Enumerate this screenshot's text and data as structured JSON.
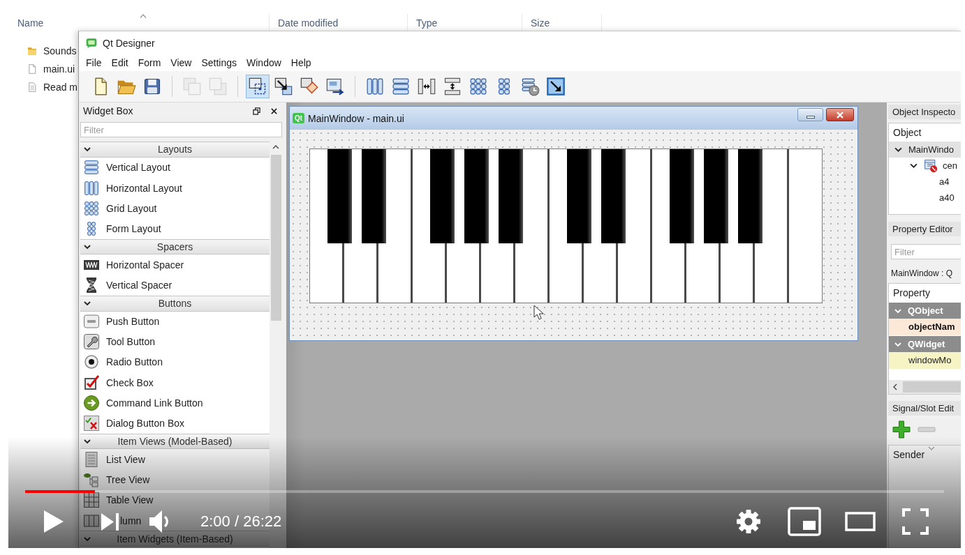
{
  "explorer": {
    "columns": [
      {
        "label": "Name",
        "sorted": true
      },
      {
        "label": "Date modified",
        "sorted": false
      },
      {
        "label": "Type",
        "sorted": false
      },
      {
        "label": "Size",
        "sorted": false
      }
    ],
    "files": [
      {
        "name": "Sounds",
        "kind": "folder"
      },
      {
        "name": "main.ui",
        "kind": "file"
      },
      {
        "name": "Read m",
        "kind": "document"
      }
    ]
  },
  "designer": {
    "title": "Qt Designer",
    "menu": [
      "File",
      "Edit",
      "Form",
      "View",
      "Settings",
      "Window",
      "Help"
    ],
    "toolbar": [
      [
        {
          "kind": "new",
          "disabled": false,
          "selected": false
        },
        {
          "kind": "open",
          "disabled": false,
          "selected": false
        },
        {
          "kind": "save",
          "disabled": false,
          "selected": false
        }
      ],
      [
        {
          "kind": "raise",
          "disabled": true,
          "selected": false
        },
        {
          "kind": "lower",
          "disabled": true,
          "selected": false
        }
      ],
      [
        {
          "kind": "edit-widgets",
          "disabled": false,
          "selected": true
        },
        {
          "kind": "edit-signals",
          "disabled": false,
          "selected": false
        },
        {
          "kind": "edit-buddies",
          "disabled": false,
          "selected": false
        },
        {
          "kind": "edit-tab-order",
          "disabled": false,
          "selected": false
        }
      ],
      [
        {
          "kind": "layout-h",
          "disabled": false,
          "selected": false
        },
        {
          "kind": "layout-v",
          "disabled": false,
          "selected": false
        },
        {
          "kind": "split-h",
          "disabled": false,
          "selected": false
        },
        {
          "kind": "split-v",
          "disabled": false,
          "selected": false
        },
        {
          "kind": "layout-grid",
          "disabled": false,
          "selected": false
        },
        {
          "kind": "layout-form",
          "disabled": false,
          "selected": false
        },
        {
          "kind": "break-layout",
          "disabled": false,
          "selected": false
        },
        {
          "kind": "adjust-size",
          "disabled": false,
          "selected": false
        }
      ]
    ],
    "widget_box": {
      "title": "Widget Box",
      "filter": {
        "placeholder": "Filter"
      },
      "groups": [
        {
          "title": "Layouts",
          "expanded": true,
          "items": [
            {
              "label": "Vertical Layout",
              "kind": "vbox"
            },
            {
              "label": "Horizontal Layout",
              "kind": "hbox"
            },
            {
              "label": "Grid Layout",
              "kind": "grid"
            },
            {
              "label": "Form Layout",
              "kind": "form"
            }
          ]
        },
        {
          "title": "Spacers",
          "expanded": true,
          "items": [
            {
              "label": "Horizontal Spacer",
              "kind": "hspacer"
            },
            {
              "label": "Vertical Spacer",
              "kind": "vspacer"
            }
          ]
        },
        {
          "title": "Buttons",
          "expanded": true,
          "items": [
            {
              "label": "Push Button",
              "kind": "push-button"
            },
            {
              "label": "Tool Button",
              "kind": "tool-button"
            },
            {
              "label": "Radio Button",
              "kind": "radio-button"
            },
            {
              "label": "Check Box",
              "kind": "check-box"
            },
            {
              "label": "Command Link Button",
              "kind": "command-link"
            },
            {
              "label": "Dialog Button Box",
              "kind": "dialog-buttons"
            }
          ]
        },
        {
          "title": "Item Views (Model-Based)",
          "expanded": true,
          "items": [
            {
              "label": "List View",
              "kind": "list-view"
            },
            {
              "label": "Tree View",
              "kind": "tree-view"
            },
            {
              "label": "Table View",
              "kind": "table-view"
            },
            {
              "label": "lumn",
              "kind": "column-view"
            }
          ]
        },
        {
          "title": "Item Widgets (Item-Based)",
          "expanded": true
        }
      ]
    },
    "form_window": {
      "logo": "Qt",
      "title": "MainWindow - main.ui"
    },
    "object_inspector": {
      "title": "Object Inspecto",
      "columns": [
        "Object"
      ],
      "tree": [
        {
          "label": "MainWindo",
          "selected": true,
          "expanded": true,
          "children": [
            {
              "label": "cen",
              "kind": "widget",
              "selected": false,
              "expanded": true,
              "children": [
                {
                  "label": "a4",
                  "selected": false
                },
                {
                  "label": "a40",
                  "selected": false
                }
              ]
            }
          ]
        }
      ]
    },
    "property_editor": {
      "title": "Property Editor",
      "filter": {
        "placeholder": "Filter"
      },
      "object": "MainWindow : Q",
      "columns": [
        "Property"
      ],
      "groups": [
        {
          "title": "QObject",
          "expanded": true,
          "color": "#fce8d6",
          "properties": [
            {
              "name": "objectNam",
              "changed": true
            }
          ]
        },
        {
          "title": "QWidget",
          "expanded": true,
          "color": "#f6f3c4",
          "properties": [
            {
              "name": "windowMo",
              "changed": false
            }
          ]
        }
      ]
    },
    "signal_slot_editor": {
      "title": "Signal/Slot Edit",
      "buttons": [
        {
          "kind": "add",
          "disabled": false
        },
        {
          "kind": "remove",
          "disabled": true
        }
      ],
      "columns": [
        "Sender"
      ]
    }
  },
  "player": {
    "playing": false,
    "progress": {
      "level": 0.076
    },
    "time": "2:00 / 26:22"
  }
}
